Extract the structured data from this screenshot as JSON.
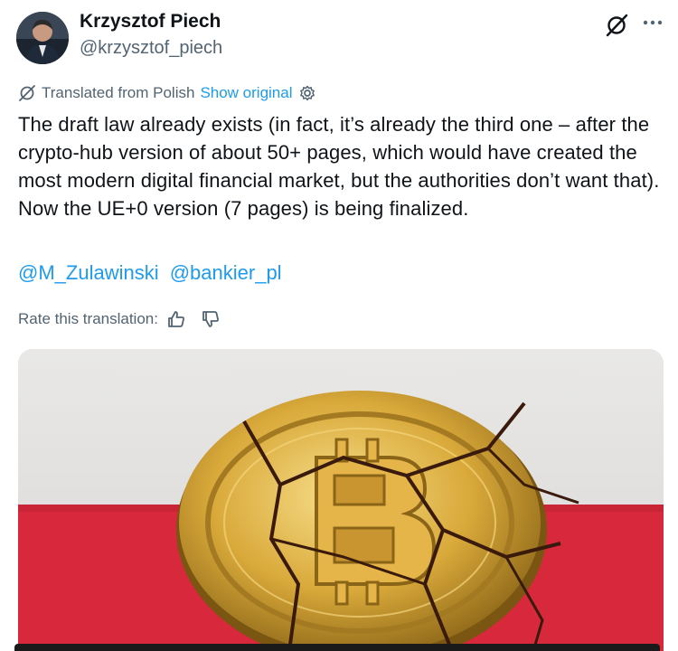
{
  "author": {
    "name": "Krzysztof Piech",
    "handle": "@krzysztof_piech"
  },
  "header_icons": {
    "grok": "grok-slash-icon",
    "more": "more-icon"
  },
  "translation": {
    "label": "Translated from Polish",
    "show_original": "Show original",
    "icon": "translate-icon",
    "settings_icon": "gear-icon"
  },
  "tweet": {
    "text": "The draft law already exists (in fact, it’s already the third one – after the crypto-hub version of about 50+ pages, which would have created the most modern digital financial market, but the authorities don’t want that). Now the UE+0 version (7 pages) is being finalized.",
    "mentions": [
      "@M_Zulawinski",
      "@bankier_pl"
    ]
  },
  "rate": {
    "label": "Rate this translation:",
    "thumbs_up_icon": "thumbs-up-icon",
    "thumbs_down_icon": "thumbs-down-icon"
  },
  "colors": {
    "text": "#0f1419",
    "secondary": "#536471",
    "link": "#1d9bf0",
    "flag_red": "#d8283c",
    "coin_gold": "#d9a93a"
  }
}
